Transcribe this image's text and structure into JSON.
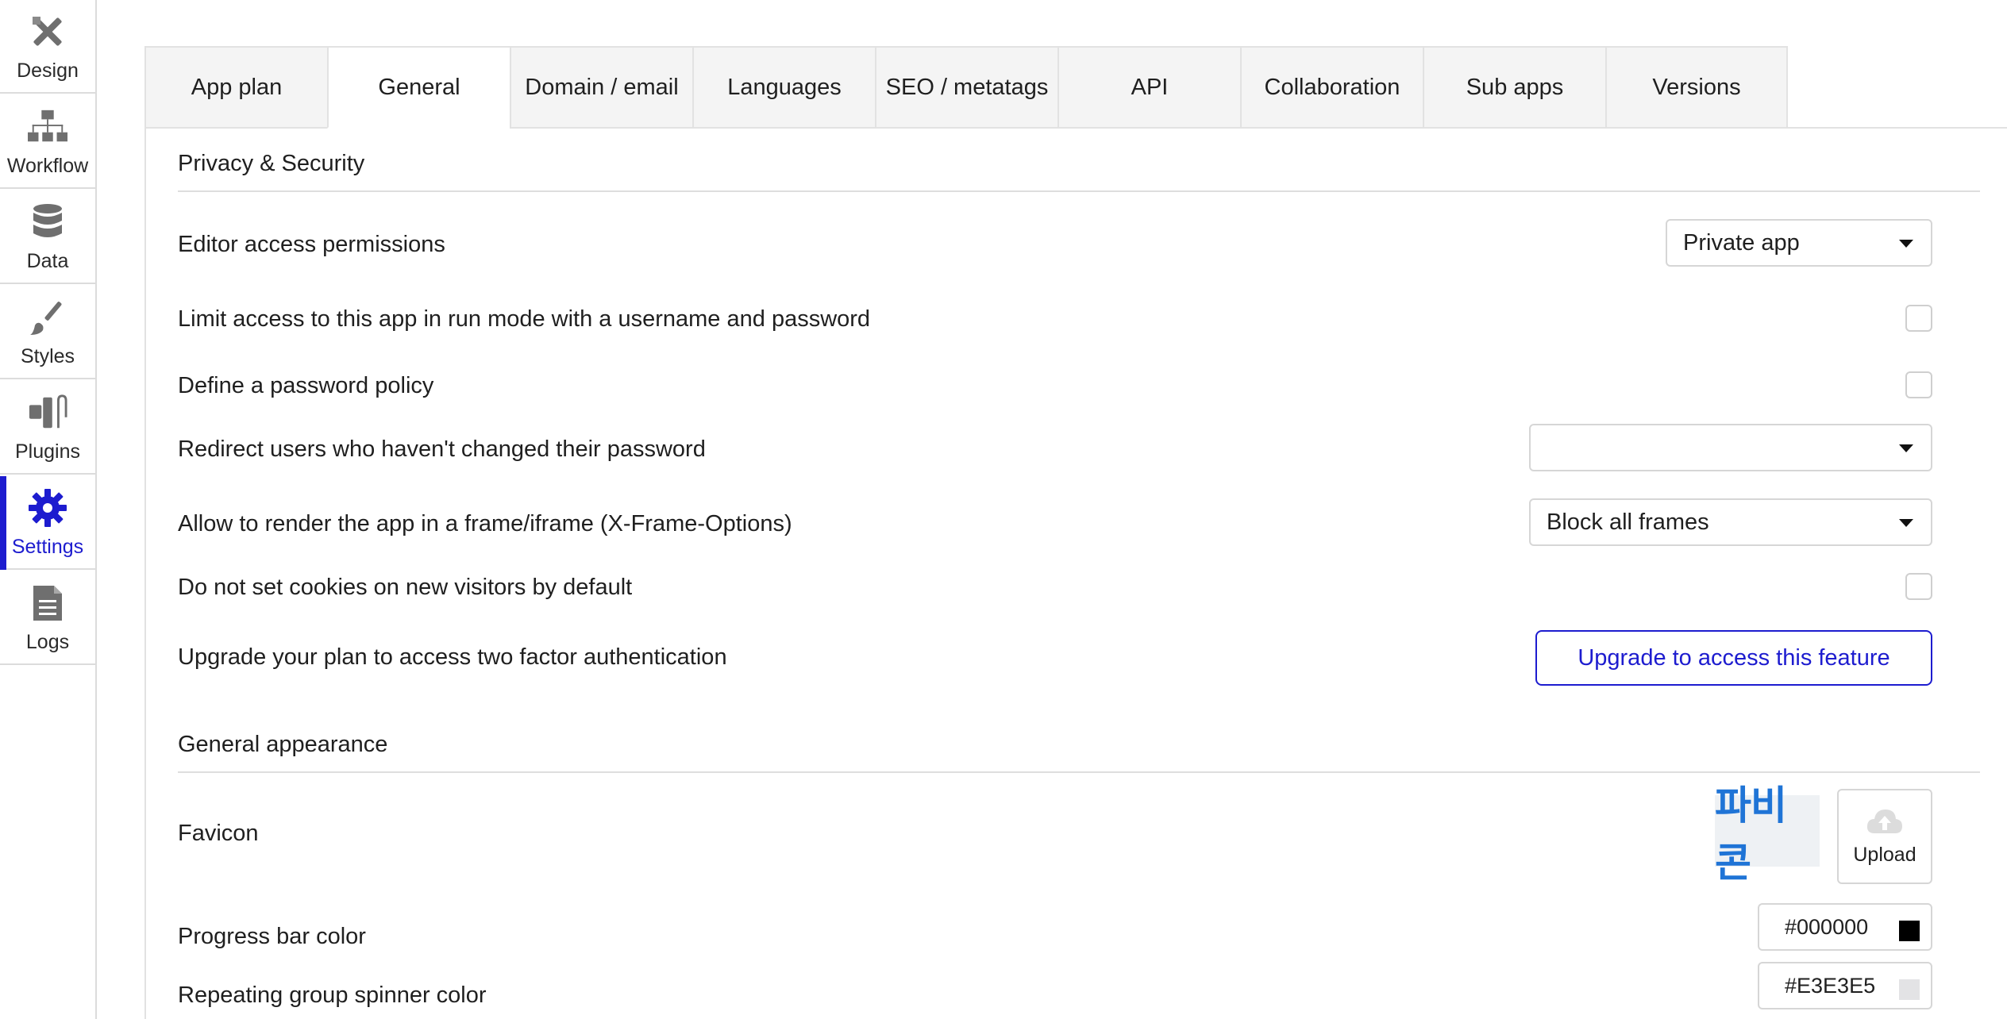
{
  "sidebar": {
    "items": [
      {
        "label": "Design",
        "icon": "design-icon"
      },
      {
        "label": "Workflow",
        "icon": "workflow-icon"
      },
      {
        "label": "Data",
        "icon": "database-icon"
      },
      {
        "label": "Styles",
        "icon": "brush-icon"
      },
      {
        "label": "Plugins",
        "icon": "plug-icon"
      },
      {
        "label": "Settings",
        "icon": "gear-icon",
        "active": true
      },
      {
        "label": "Logs",
        "icon": "document-icon"
      }
    ]
  },
  "tabs": [
    "App plan",
    "General",
    "Domain / email",
    "Languages",
    "SEO / metatags",
    "API",
    "Collaboration",
    "Sub apps",
    "Versions"
  ],
  "active_tab": "General",
  "privacy": {
    "title": "Privacy & Security",
    "editor_access_label": "Editor access permissions",
    "editor_access_value": "Private app",
    "limit_access_label": "Limit access to this app in run mode with a username and password",
    "limit_access_checked": false,
    "password_policy_label": "Define a password policy",
    "password_policy_checked": false,
    "redirect_label": "Redirect users who haven't changed their password",
    "redirect_value": "",
    "iframe_label": "Allow to render the app in a frame/iframe (X-Frame-Options)",
    "iframe_value": "Block all frames",
    "cookies_label": "Do not set cookies on new visitors by default",
    "cookies_checked": false,
    "twofactor_label": "Upgrade your plan to access two factor authentication",
    "twofactor_button": "Upgrade to access this feature"
  },
  "appearance": {
    "title": "General appearance",
    "favicon_label": "Favicon",
    "favicon_preview_text": "파비콘",
    "upload_label": "Upload",
    "progress_label": "Progress bar color",
    "progress_color": "#000000",
    "spinner_label": "Repeating group spinner color",
    "spinner_color": "#E3E3E5"
  },
  "colors": {
    "accent": "#1d1ccf",
    "favicon_text": "#1f74d6"
  }
}
